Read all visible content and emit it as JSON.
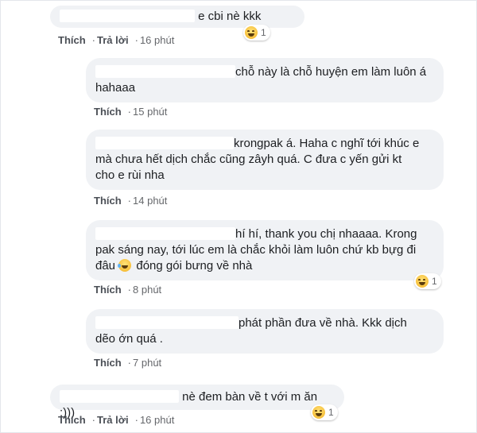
{
  "actions": {
    "like": "Thích",
    "reply": "Trả lời",
    "dot": "·"
  },
  "comments": [
    {
      "text": "e cbi nè kkk",
      "time": "16 phút",
      "reaction_count": "1"
    },
    {
      "text_line1": "chỗ này là chỗ huyện em làm luôn á",
      "text_line2": "hahaaa",
      "time": "15 phút"
    },
    {
      "text_line1": "krongpak á. Haha c nghĩ tới khúc e",
      "text_line2": "mà chưa hết dịch chắc cũng zâyh quá. C đưa c yến gửi kt",
      "text_line3": "cho e rùi nha",
      "time": "14 phút"
    },
    {
      "text_line1": "hí hí, thank you chị nhaaaa. Krong",
      "text_line2": "pak sáng nay, tới lúc em là chắc khỏi làm luôn chứ kb bựg đi",
      "text_line3_pre": "đâu",
      "text_line3_post": "đóng gói bưng về nhà",
      "time": "8 phút",
      "reaction_count": "1"
    },
    {
      "text_line1": "phát phần đưa về nhà. Kkk dịch",
      "text_line2": "dẽo ớn quá .",
      "time": "7 phút"
    },
    {
      "text": "nè đem bàn về t với m ăn :)))",
      "time": "16 phút",
      "reaction_count": "1"
    }
  ],
  "icons": {
    "reaction": "haha-reaction-icon",
    "inline": "laughing-tears-emoji-icon"
  }
}
